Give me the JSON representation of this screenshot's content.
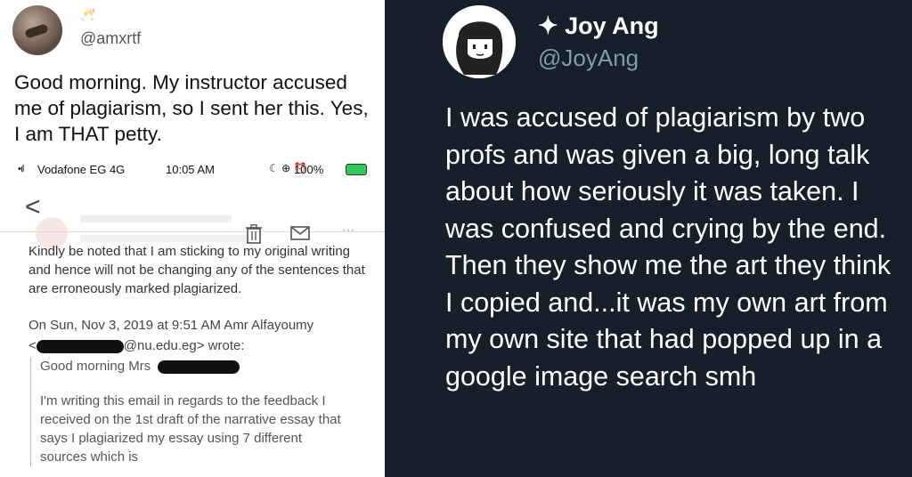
{
  "left": {
    "emoji": "🥂",
    "handle": "@amxrtf",
    "tweet": "Good morning. My instructor accused me of plagiarism, so I sent her this. Yes, I am THAT petty.",
    "phone": {
      "signal": "•ıl",
      "carrier": "Vodafone EG  4G",
      "time": "10:05 AM",
      "status_icons": "☾ ⊕ ⏰",
      "battery": "100%",
      "back": "<",
      "dots": "⋯",
      "body_p1": "Kindly be noted that I am sticking to my original writing and hence will not be changing any of the sentences that are erroneously marked plagiarized.",
      "quote_header": "On Sun, Nov 3, 2019 at 9:51 AM Amr Alfayoumy",
      "quote_email": "@nu.edu.eg> wrote:",
      "quote_lt": "<",
      "greeting": "Good morning Mrs",
      "quote_body": "I'm writing this email in regards to the feedback I received on the 1st draft of the narrative essay that says I plagiarized my essay using 7 different sources which is"
    }
  },
  "right": {
    "name": "✦ Joy Ang",
    "handle": "@JoyAng",
    "tweet": "I was accused of plagiarism by two profs and was given a big, long talk about how seriously it was taken. I was confused and crying by the end. Then they show me the art they think I copied and...it was my own art from my own site that had popped up in a google image search smh"
  }
}
